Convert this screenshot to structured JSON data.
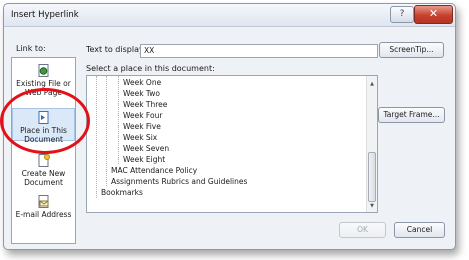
{
  "window": {
    "title": "Insert Hyperlink",
    "help_glyph": "?",
    "close_glyph": "✕"
  },
  "link_to": {
    "label": "Link to:",
    "items": [
      {
        "label": "Existing File or Web Page",
        "icon": "globe-document-icon"
      },
      {
        "label": "Place in This Document",
        "icon": "document-place-icon",
        "selected": true
      },
      {
        "label": "Create New Document",
        "icon": "new-document-icon"
      },
      {
        "label": "E-mail Address",
        "icon": "email-icon"
      }
    ]
  },
  "text_to_display": {
    "label": "Text to display:",
    "value": "XX"
  },
  "screentip_button": "ScreenTip...",
  "select_place_label": "Select a place in this document:",
  "tree": {
    "items": [
      "Week One",
      "Week Two",
      "Week Three",
      "Week Four",
      "Week Five",
      "Week Six",
      "Week Seven",
      "Week Eight",
      "MAC Attendance Policy",
      "Assignments Rubrics and Guidelines",
      "Bookmarks"
    ]
  },
  "target_frame_button": "Target Frame...",
  "ok_button": "OK",
  "cancel_button": "Cancel",
  "colors": {
    "highlight_circle": "#e3101a",
    "close_button": "#c8402e"
  }
}
